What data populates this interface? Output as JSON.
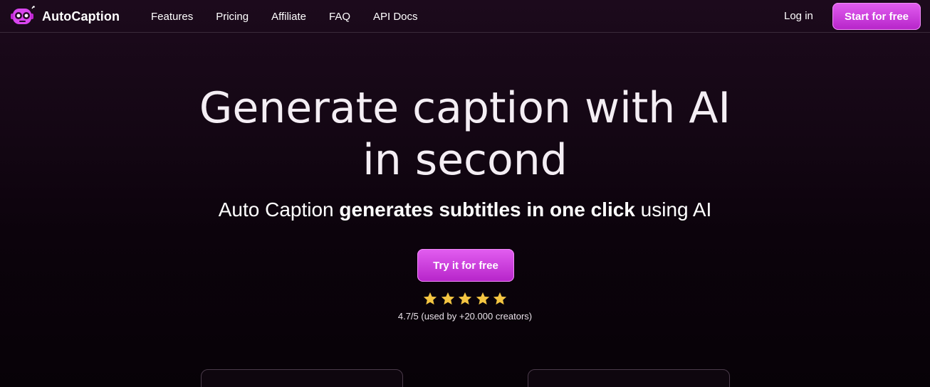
{
  "brand": {
    "name": "AutoCaption",
    "logo_icon": "robot-head-icon",
    "accent": "#d946ef"
  },
  "nav": {
    "links": [
      {
        "label": "Features"
      },
      {
        "label": "Pricing"
      },
      {
        "label": "Affiliate"
      },
      {
        "label": "FAQ"
      },
      {
        "label": "API Docs"
      }
    ],
    "login_label": "Log in",
    "start_label": "Start for free"
  },
  "hero": {
    "title_line1": "Generate caption with AI",
    "title_line2": "in second",
    "subtitle_pre": "Auto Caption ",
    "subtitle_bold": "generates subtitles in one click",
    "subtitle_post": " using AI",
    "cta_label": "Try it for free",
    "rating": {
      "stars": 5,
      "star_icon": "star-icon",
      "star_color": "#f5c542",
      "text": "4.7/5 (used by +20.000 creators)"
    }
  }
}
